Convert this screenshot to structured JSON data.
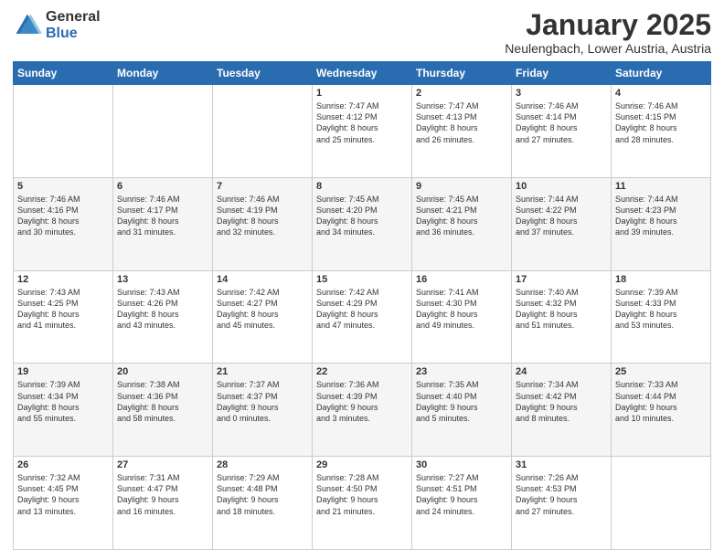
{
  "logo": {
    "general": "General",
    "blue": "Blue"
  },
  "header": {
    "month": "January 2025",
    "location": "Neulengbach, Lower Austria, Austria"
  },
  "weekdays": [
    "Sunday",
    "Monday",
    "Tuesday",
    "Wednesday",
    "Thursday",
    "Friday",
    "Saturday"
  ],
  "weeks": [
    [
      {
        "day": "",
        "info": ""
      },
      {
        "day": "",
        "info": ""
      },
      {
        "day": "",
        "info": ""
      },
      {
        "day": "1",
        "info": "Sunrise: 7:47 AM\nSunset: 4:12 PM\nDaylight: 8 hours\nand 25 minutes."
      },
      {
        "day": "2",
        "info": "Sunrise: 7:47 AM\nSunset: 4:13 PM\nDaylight: 8 hours\nand 26 minutes."
      },
      {
        "day": "3",
        "info": "Sunrise: 7:46 AM\nSunset: 4:14 PM\nDaylight: 8 hours\nand 27 minutes."
      },
      {
        "day": "4",
        "info": "Sunrise: 7:46 AM\nSunset: 4:15 PM\nDaylight: 8 hours\nand 28 minutes."
      }
    ],
    [
      {
        "day": "5",
        "info": "Sunrise: 7:46 AM\nSunset: 4:16 PM\nDaylight: 8 hours\nand 30 minutes."
      },
      {
        "day": "6",
        "info": "Sunrise: 7:46 AM\nSunset: 4:17 PM\nDaylight: 8 hours\nand 31 minutes."
      },
      {
        "day": "7",
        "info": "Sunrise: 7:46 AM\nSunset: 4:19 PM\nDaylight: 8 hours\nand 32 minutes."
      },
      {
        "day": "8",
        "info": "Sunrise: 7:45 AM\nSunset: 4:20 PM\nDaylight: 8 hours\nand 34 minutes."
      },
      {
        "day": "9",
        "info": "Sunrise: 7:45 AM\nSunset: 4:21 PM\nDaylight: 8 hours\nand 36 minutes."
      },
      {
        "day": "10",
        "info": "Sunrise: 7:44 AM\nSunset: 4:22 PM\nDaylight: 8 hours\nand 37 minutes."
      },
      {
        "day": "11",
        "info": "Sunrise: 7:44 AM\nSunset: 4:23 PM\nDaylight: 8 hours\nand 39 minutes."
      }
    ],
    [
      {
        "day": "12",
        "info": "Sunrise: 7:43 AM\nSunset: 4:25 PM\nDaylight: 8 hours\nand 41 minutes."
      },
      {
        "day": "13",
        "info": "Sunrise: 7:43 AM\nSunset: 4:26 PM\nDaylight: 8 hours\nand 43 minutes."
      },
      {
        "day": "14",
        "info": "Sunrise: 7:42 AM\nSunset: 4:27 PM\nDaylight: 8 hours\nand 45 minutes."
      },
      {
        "day": "15",
        "info": "Sunrise: 7:42 AM\nSunset: 4:29 PM\nDaylight: 8 hours\nand 47 minutes."
      },
      {
        "day": "16",
        "info": "Sunrise: 7:41 AM\nSunset: 4:30 PM\nDaylight: 8 hours\nand 49 minutes."
      },
      {
        "day": "17",
        "info": "Sunrise: 7:40 AM\nSunset: 4:32 PM\nDaylight: 8 hours\nand 51 minutes."
      },
      {
        "day": "18",
        "info": "Sunrise: 7:39 AM\nSunset: 4:33 PM\nDaylight: 8 hours\nand 53 minutes."
      }
    ],
    [
      {
        "day": "19",
        "info": "Sunrise: 7:39 AM\nSunset: 4:34 PM\nDaylight: 8 hours\nand 55 minutes."
      },
      {
        "day": "20",
        "info": "Sunrise: 7:38 AM\nSunset: 4:36 PM\nDaylight: 8 hours\nand 58 minutes."
      },
      {
        "day": "21",
        "info": "Sunrise: 7:37 AM\nSunset: 4:37 PM\nDaylight: 9 hours\nand 0 minutes."
      },
      {
        "day": "22",
        "info": "Sunrise: 7:36 AM\nSunset: 4:39 PM\nDaylight: 9 hours\nand 3 minutes."
      },
      {
        "day": "23",
        "info": "Sunrise: 7:35 AM\nSunset: 4:40 PM\nDaylight: 9 hours\nand 5 minutes."
      },
      {
        "day": "24",
        "info": "Sunrise: 7:34 AM\nSunset: 4:42 PM\nDaylight: 9 hours\nand 8 minutes."
      },
      {
        "day": "25",
        "info": "Sunrise: 7:33 AM\nSunset: 4:44 PM\nDaylight: 9 hours\nand 10 minutes."
      }
    ],
    [
      {
        "day": "26",
        "info": "Sunrise: 7:32 AM\nSunset: 4:45 PM\nDaylight: 9 hours\nand 13 minutes."
      },
      {
        "day": "27",
        "info": "Sunrise: 7:31 AM\nSunset: 4:47 PM\nDaylight: 9 hours\nand 16 minutes."
      },
      {
        "day": "28",
        "info": "Sunrise: 7:29 AM\nSunset: 4:48 PM\nDaylight: 9 hours\nand 18 minutes."
      },
      {
        "day": "29",
        "info": "Sunrise: 7:28 AM\nSunset: 4:50 PM\nDaylight: 9 hours\nand 21 minutes."
      },
      {
        "day": "30",
        "info": "Sunrise: 7:27 AM\nSunset: 4:51 PM\nDaylight: 9 hours\nand 24 minutes."
      },
      {
        "day": "31",
        "info": "Sunrise: 7:26 AM\nSunset: 4:53 PM\nDaylight: 9 hours\nand 27 minutes."
      },
      {
        "day": "",
        "info": ""
      }
    ]
  ]
}
